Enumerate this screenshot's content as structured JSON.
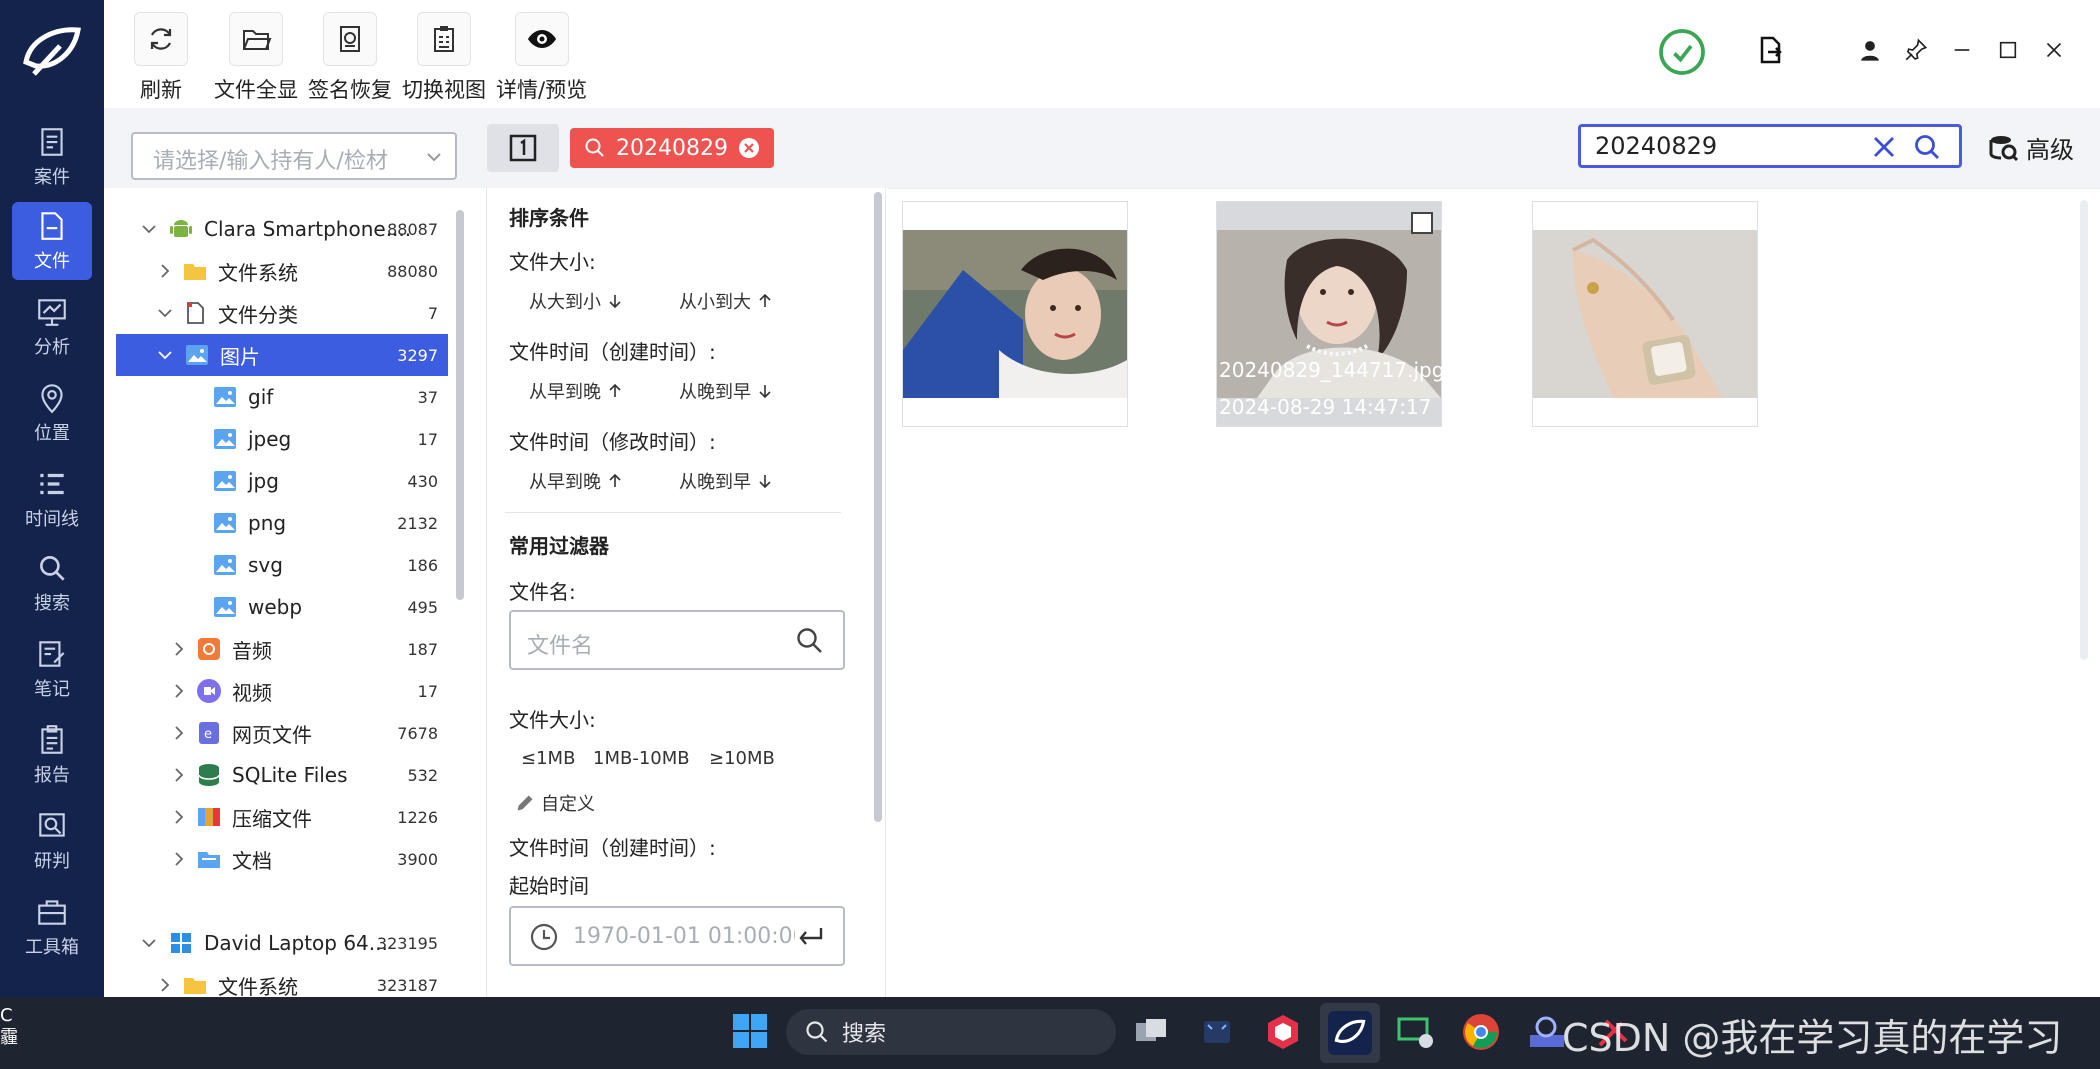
{
  "nav": {
    "items": [
      {
        "label": "案件",
        "icon": "case-icon"
      },
      {
        "label": "文件",
        "icon": "file-icon"
      },
      {
        "label": "分析",
        "icon": "analysis-icon"
      },
      {
        "label": "位置",
        "icon": "location-icon"
      },
      {
        "label": "时间线",
        "icon": "timeline-icon"
      },
      {
        "label": "搜索",
        "icon": "search-icon"
      },
      {
        "label": "笔记",
        "icon": "note-icon"
      },
      {
        "label": "报告",
        "icon": "report-icon"
      },
      {
        "label": "研判",
        "icon": "judge-icon"
      },
      {
        "label": "工具箱",
        "icon": "toolbox-icon"
      }
    ],
    "active_index": 1
  },
  "toolbar": {
    "refresh": "刷新",
    "show_all": "文件全显",
    "signature_restore": "签名恢复",
    "switch_view": "切换视图",
    "detail_preview": "详情/预览"
  },
  "search": {
    "owner_placeholder": "请选择/输入持有人/检材",
    "active_tag": "20240829",
    "query": "20240829",
    "advanced": "高级"
  },
  "tree": {
    "rows": [
      {
        "label": "Clara Smartphone....",
        "count": "88087"
      },
      {
        "label": "文件系统",
        "count": "88080"
      },
      {
        "label": "文件分类",
        "count": "7"
      },
      {
        "label": "图片",
        "count": "3297"
      },
      {
        "label": "gif",
        "count": "37"
      },
      {
        "label": "jpeg",
        "count": "17"
      },
      {
        "label": "jpg",
        "count": "430"
      },
      {
        "label": "png",
        "count": "2132"
      },
      {
        "label": "svg",
        "count": "186"
      },
      {
        "label": "webp",
        "count": "495"
      },
      {
        "label": "音频",
        "count": "187"
      },
      {
        "label": "视频",
        "count": "17"
      },
      {
        "label": "网页文件",
        "count": "7678"
      },
      {
        "label": "SQLite Files",
        "count": "532"
      },
      {
        "label": "压缩文件",
        "count": "1226"
      },
      {
        "label": "文档",
        "count": "3900"
      },
      {
        "label": "David Laptop 64...",
        "count": "323195"
      },
      {
        "label": "文件系统",
        "count": "323187"
      }
    ]
  },
  "filter": {
    "sort_title": "排序条件",
    "size_label": "文件大小:",
    "size_desc": "从大到小",
    "size_asc": "从小到大",
    "ctime_label": "文件时间（创建时间）:",
    "early_to_late": "从早到晚",
    "late_to_early": "从晚到早",
    "mtime_label": "文件时间（修改时间）:",
    "common_title": "常用过滤器",
    "filename_label": "文件名:",
    "filename_placeholder": "文件名",
    "size_label2": "文件大小:",
    "size_le1": "≤1MB",
    "size_1_10": "1MB-10MB",
    "size_ge10": "≥10MB",
    "custom": "自定义",
    "ctime_label2": "文件时间（创建时间）:",
    "start_time": "起始时间",
    "start_placeholder": "1970-01-01 01:00:00"
  },
  "gallery": {
    "items": [
      {
        "name": "",
        "time": ""
      },
      {
        "name": "20240829_144717.jpg",
        "time": "2024-08-29 14:47:17"
      },
      {
        "name": "",
        "time": ""
      }
    ]
  },
  "taskbar": {
    "left_line1": "C",
    "left_line2": "霾",
    "search": "搜索",
    "watermark": "CSDN @我在学习真的在学习"
  },
  "colors": {
    "nav_bg": "#14234b",
    "accent": "#3d5de0",
    "tag": "#ef5350"
  }
}
